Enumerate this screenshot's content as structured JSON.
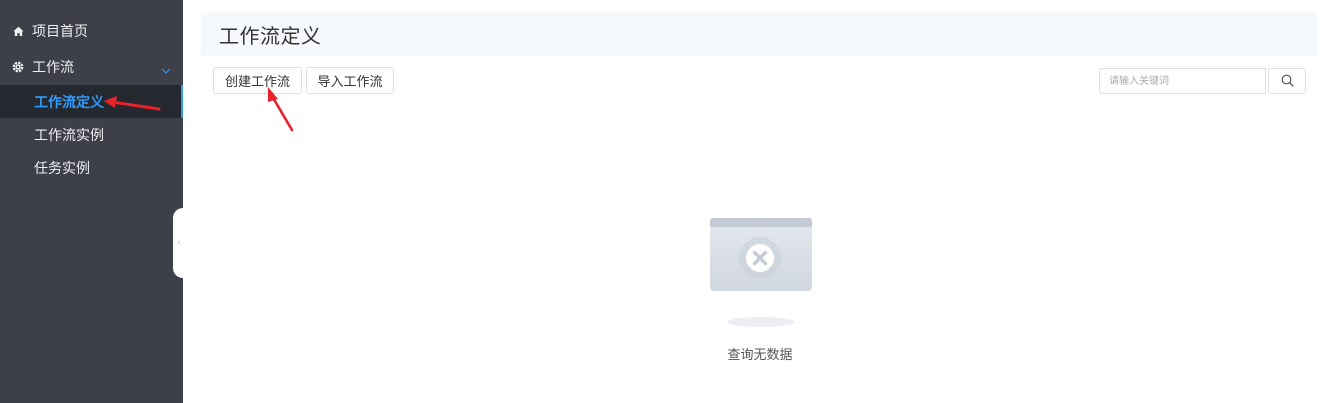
{
  "sidebar": {
    "items": [
      {
        "label": "项目首页",
        "icon": "home-icon"
      },
      {
        "label": "工作流",
        "icon": "gear-icon",
        "expanded": true,
        "children": [
          {
            "label": "工作流定义",
            "active": true
          },
          {
            "label": "工作流实例"
          },
          {
            "label": "任务实例"
          }
        ]
      }
    ]
  },
  "header": {
    "title": "工作流定义"
  },
  "toolbar": {
    "create_label": "创建工作流",
    "import_label": "导入工作流",
    "search_placeholder": "请输入关键词"
  },
  "empty_state": {
    "text": "查询无数据",
    "icon": "empty-box-icon"
  },
  "colors": {
    "sidebar_bg": "#3e4049",
    "active_bg": "#262830",
    "accent": "#2f9bff",
    "annotation": "#e8222b"
  }
}
